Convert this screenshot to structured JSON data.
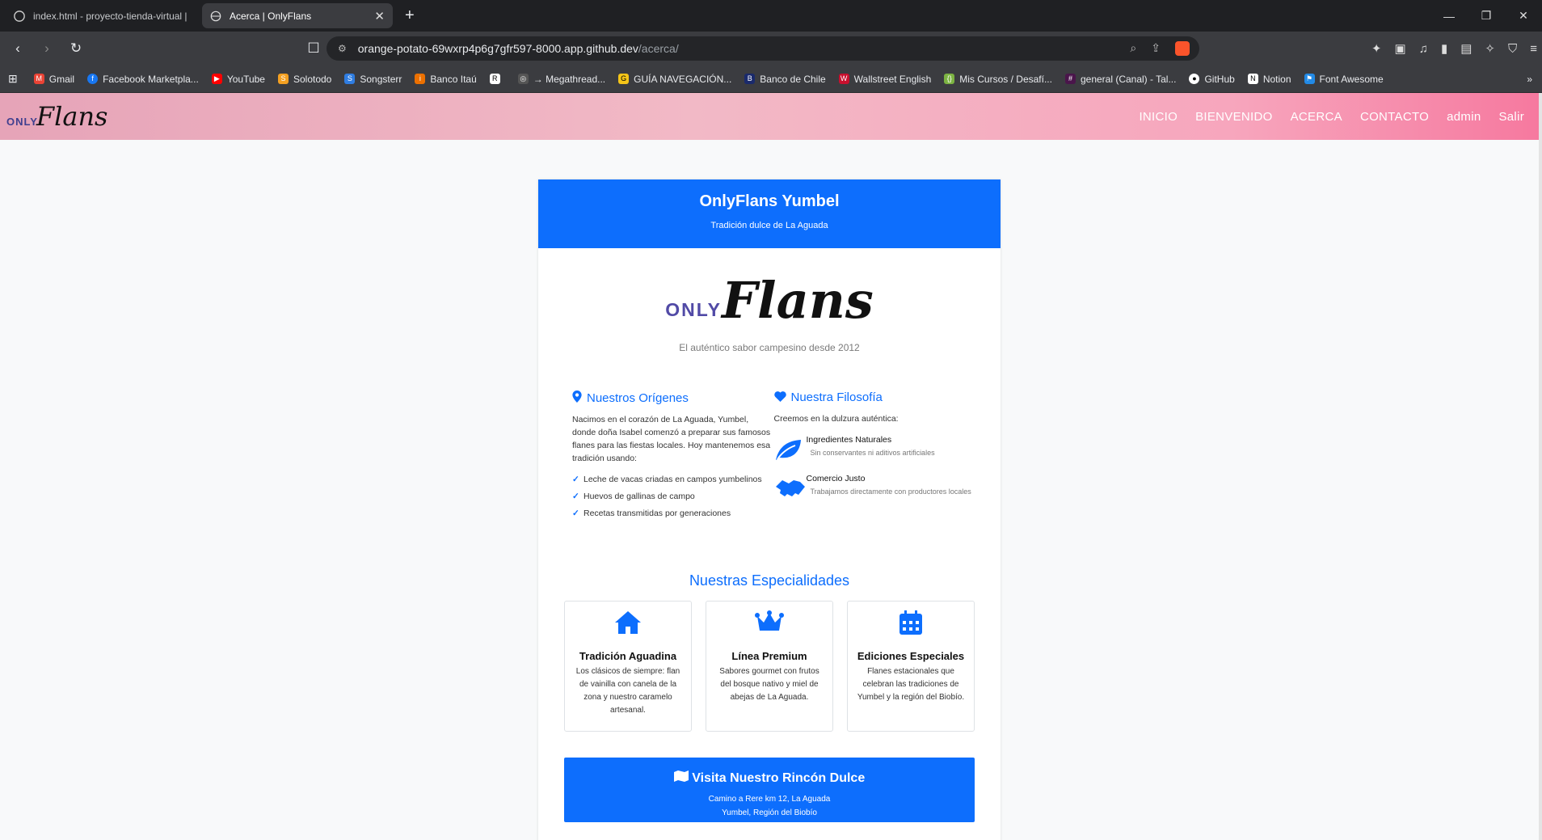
{
  "browser": {
    "tabs": [
      {
        "title": "index.html - proyecto-tienda-virtual |",
        "active": false
      },
      {
        "title": "Acerca | OnlyFlans",
        "active": true
      }
    ],
    "url_host": "orange-potato-69wxrp4p6g7gfr597-8000.app.github.dev",
    "url_path": "/acerca/",
    "bookmarks": [
      "Gmail",
      "Facebook Marketpla...",
      "YouTube",
      "Solotodo",
      "Songsterr",
      "Banco Itaú",
      "",
      "→ Megathread...",
      "GUÍA NAVEGACIÓN...",
      "Banco de Chile",
      "Wallstreet English",
      "Mis Cursos / Desafí...",
      "general (Canal) - Tal...",
      "GitHub",
      "Notion",
      "Font Awesome"
    ]
  },
  "site": {
    "logo_only": "ONLY",
    "logo_flans": "Flans",
    "nav": [
      "INICIO",
      "BIENVENIDO",
      "ACERCA",
      "CONTACTO",
      "admin",
      "Salir"
    ]
  },
  "card": {
    "title": "OnlyFlans Yumbel",
    "subtitle": "Tradición dulce de La Aguada",
    "tagline": "El auténtico sabor campesino desde 2012",
    "origins": {
      "heading": "Nuestros Orígenes",
      "text": "Nacimos en el corazón de La Aguada, Yumbel, donde doña Isabel comenzó a preparar sus famosos flanes para las fiestas locales. Hoy mantenemos esa tradición usando:",
      "items": [
        "Leche de vacas criadas en campos yumbelinos",
        "Huevos de gallinas de campo",
        "Recetas transmitidas por generaciones"
      ]
    },
    "philosophy": {
      "heading": "Nuestra Filosofía",
      "text": "Creemos en la dulzura auténtica:",
      "features": [
        {
          "title": "Ingredientes Naturales",
          "desc": "Sin conservantes ni aditivos artificiales",
          "icon": "leaf-icon"
        },
        {
          "title": "Comercio Justo",
          "desc": "Trabajamos directamente con productores locales",
          "icon": "handshake-icon"
        }
      ]
    },
    "specialties_title": "Nuestras Especialidades",
    "specialties": [
      {
        "title": "Tradición Aguadina",
        "desc": "Los clásicos de siempre: flan de vainilla con canela de la zona y nuestro caramelo artesanal.",
        "icon": "home-icon"
      },
      {
        "title": "Línea Premium",
        "desc": "Sabores gourmet con frutos del bosque nativo y miel de abejas de La Aguada.",
        "icon": "crown-icon"
      },
      {
        "title": "Ediciones Especiales",
        "desc": "Flanes estacionales que celebran las tradiciones de Yumbel y la región del Biobío.",
        "icon": "calendar-icon"
      }
    ],
    "visit": {
      "title": "Visita Nuestro Rincón Dulce",
      "line1": "Camino a Rere km 12, La Aguada",
      "line2": "Yumbel, Región del Biobío"
    }
  },
  "colors": {
    "primary": "#0d6efd",
    "header_pink": "#f2b9c6"
  }
}
